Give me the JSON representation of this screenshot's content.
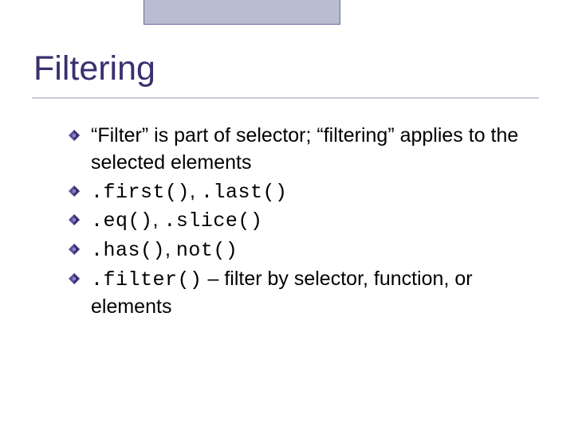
{
  "title": "Filtering",
  "items": [
    {
      "text_a": "“Filter” is part of selector; “filtering” applies to the selected elements",
      "mono_a": "",
      "text_b": "",
      "mono_b": ""
    },
    {
      "text_a": "",
      "mono_a": ".first()",
      "text_b": ", ",
      "mono_b": ".last()"
    },
    {
      "text_a": "",
      "mono_a": ".eq()",
      "text_b": ", ",
      "mono_b": ".slice()"
    },
    {
      "text_a": "",
      "mono_a": ".has()",
      "text_b": ", ",
      "mono_b": "not()"
    },
    {
      "text_a": "",
      "mono_a": ".filter()",
      "text_b": " – filter by selector, function, or elements",
      "mono_b": ""
    }
  ]
}
